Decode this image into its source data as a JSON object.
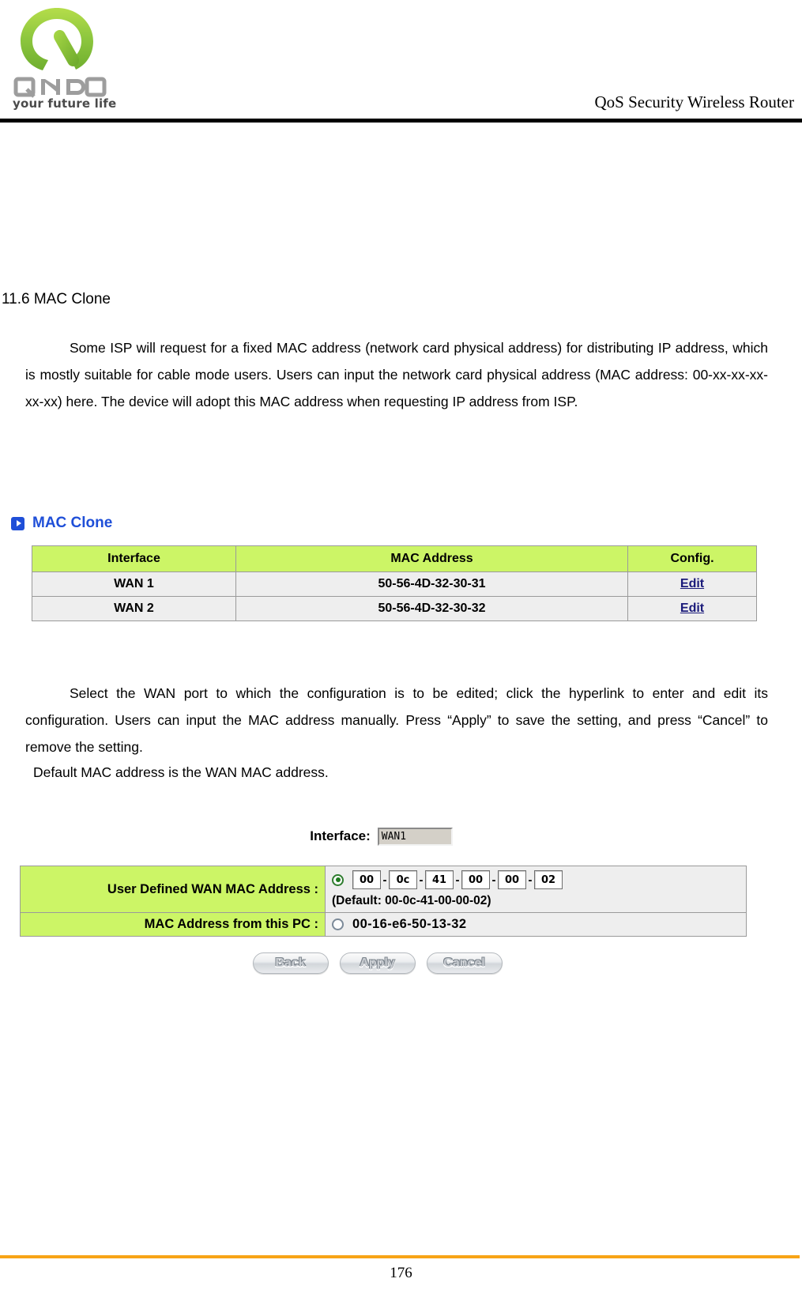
{
  "header": {
    "logo_word": "QNO",
    "logo_tagline": "your future life",
    "title": "QoS Security Wireless Router"
  },
  "section": {
    "heading": "11.6 MAC Clone",
    "paragraph_1": "Some ISP will request for a fixed MAC address (network card physical address) for distributing IP address, which is mostly suitable for cable mode users. Users can input the network card physical address (MAC address: 00-xx-xx-xx-xx-xx) here. The device will adopt this MAC address when requesting IP address from ISP.",
    "paragraph_2": "Select the WAN port to which the configuration is to be edited; click the hyperlink to enter and edit its configuration. Users can input the MAC address manually. Press “Apply” to save the setting, and press “Cancel” to remove the setting.",
    "paragraph_3": "Default MAC address is the WAN MAC address."
  },
  "mac_clone_panel": {
    "title": "MAC Clone",
    "columns": [
      "Interface",
      "MAC Address",
      "Config."
    ],
    "rows": [
      {
        "interface": "WAN 1",
        "mac": "50-56-4D-32-30-31",
        "config": "Edit"
      },
      {
        "interface": "WAN 2",
        "mac": "50-56-4D-32-30-32",
        "config": "Edit"
      }
    ]
  },
  "edit_panel": {
    "interface_label": "Interface:",
    "interface_value": "WAN1",
    "user_defined_label": "User Defined WAN MAC Address :",
    "octets": [
      "00",
      "0c",
      "41",
      "00",
      "00",
      "02"
    ],
    "separator": "-",
    "default_note": "(Default: 00-0c-41-00-00-02)",
    "pc_mac_label": "MAC Address from this PC :",
    "pc_mac_value": "00-16-e6-50-13-32",
    "selected_option": "user_defined",
    "buttons": {
      "back": "Back",
      "apply": "Apply",
      "cancel": "Cancel"
    }
  },
  "footer": {
    "page_number": "176",
    "rule_color": "#f7a416"
  },
  "colors": {
    "table_header_green": "#ccf566",
    "table_row_gray": "#eeeeee",
    "panel_title_blue": "#1f4fd8",
    "link_blue": "#1a1a7a"
  }
}
